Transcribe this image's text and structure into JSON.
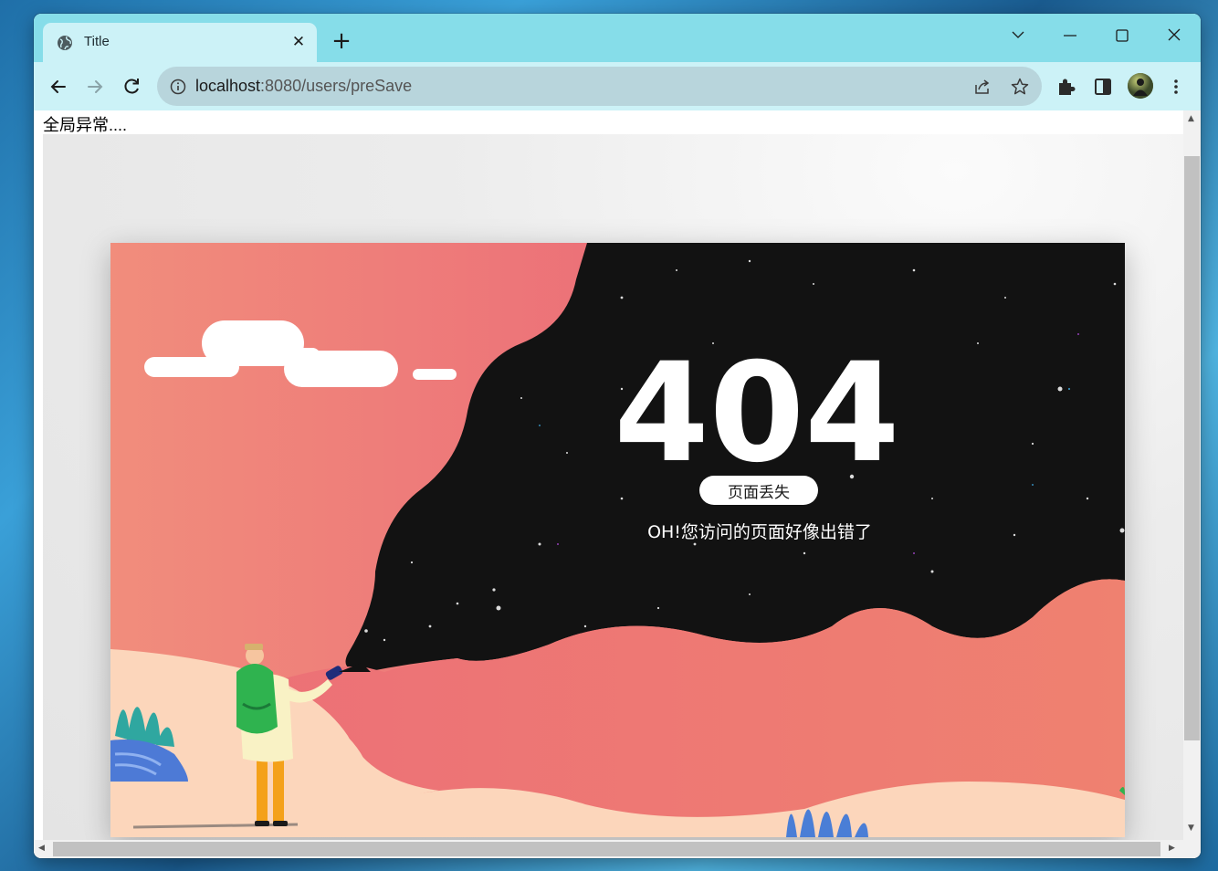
{
  "tab": {
    "title": "Title",
    "favicon": "globe-icon"
  },
  "window_controls": [
    "chevron-down-icon",
    "minimize-icon",
    "maximize-icon",
    "close-icon"
  ],
  "address": {
    "host": "localhost",
    "path": ":8080/users/preSave"
  },
  "page": {
    "error_text": "全局异常....",
    "code": "404",
    "badge": "页面丢失",
    "message": "OH!您访问的页面好像出错了"
  },
  "colors": {
    "tabstrip": "#86dde9",
    "toolbar": "#ccf2f7",
    "omnibox": "#b8d5dc",
    "sky": "#ee7f7c",
    "space": "#121212"
  }
}
